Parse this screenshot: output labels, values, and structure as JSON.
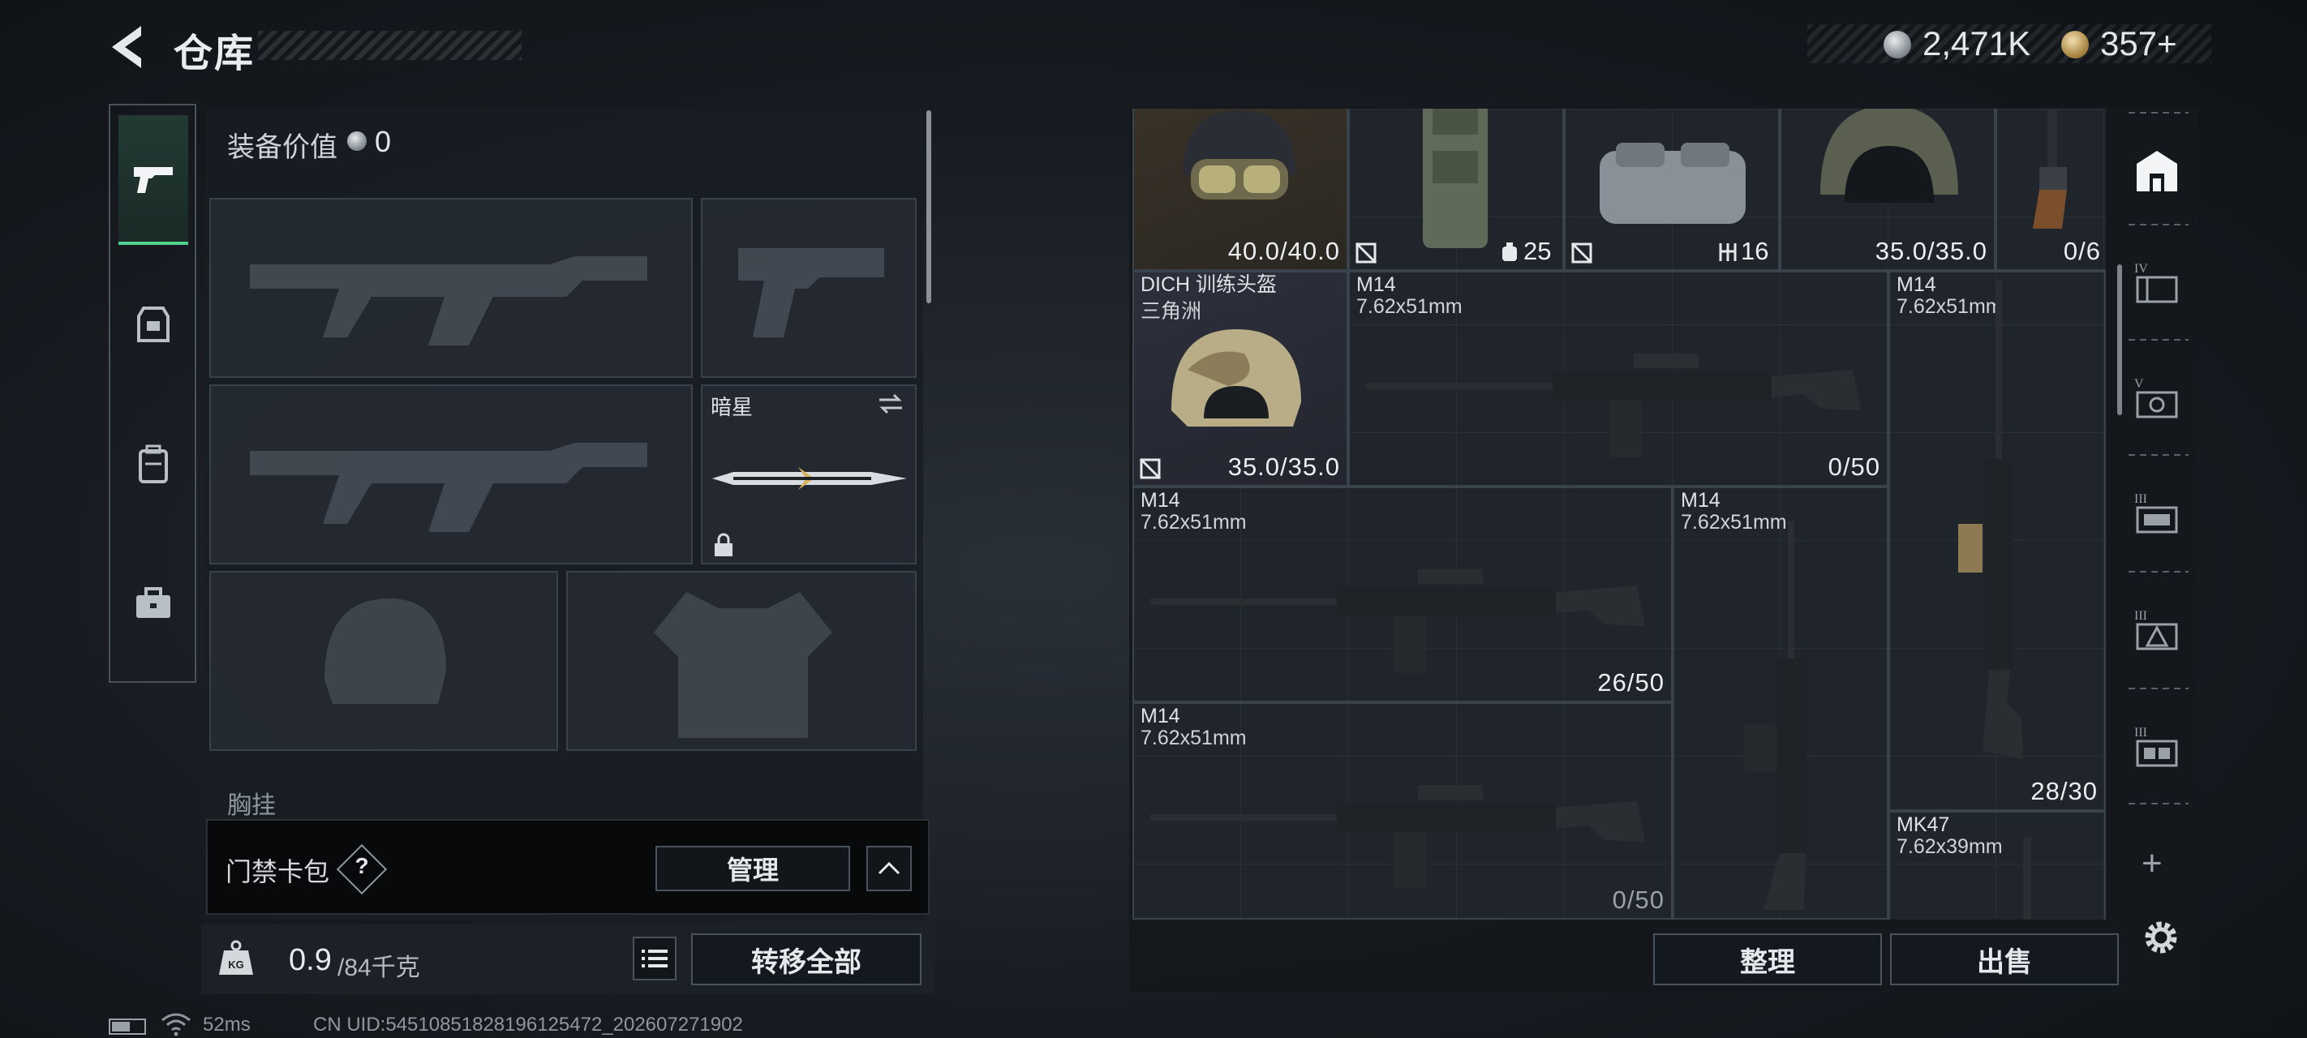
{
  "header": {
    "title": "仓库",
    "currency": {
      "silver": "2,471K",
      "gold": "357+"
    }
  },
  "left_tabs": [
    {
      "name": "firearms",
      "icon": "pistol-icon",
      "active": true
    },
    {
      "name": "helmet-armor",
      "icon": "armor-icon",
      "active": false
    },
    {
      "name": "backpack",
      "icon": "backpack-icon",
      "active": false
    },
    {
      "name": "briefcase",
      "icon": "briefcase-icon",
      "active": false
    }
  ],
  "equipment": {
    "value_label": "装备价值",
    "value": "0",
    "melee_name": "暗星",
    "chest_label": "胸挂",
    "chest_help": "?"
  },
  "access_card": {
    "label": "门禁卡包",
    "help": "?",
    "manage_label": "管理"
  },
  "weight": {
    "current": "0.9",
    "capacity": "/84千克",
    "transfer_all_label": "转移全部"
  },
  "status": {
    "ping": "52ms",
    "uid": "CN UID:545108518281961254​72_202607271902"
  },
  "stash": {
    "items": [
      {
        "id": "helmet-goggles",
        "count": "40.0/40.0",
        "rarity": "rare"
      },
      {
        "id": "vest",
        "badge": "no-insure",
        "count": "25"
      },
      {
        "id": "bag",
        "badge": "no-insure",
        "count": "16"
      },
      {
        "id": "helmet-2",
        "count": "35.0/35.0"
      },
      {
        "id": "revolver",
        "count": "0/6"
      },
      {
        "id": "dich-helmet",
        "name": "DICH 训练头盔",
        "sub": "三角洲",
        "count": "35.0/35.0",
        "rarity": "epic"
      },
      {
        "id": "m14-a",
        "name": "M14",
        "sub": "7.62x51mm",
        "count": "0/50"
      },
      {
        "id": "m14-b",
        "name": "M14",
        "sub": "7.62x51mm",
        "count": "28/30"
      },
      {
        "id": "m14-c",
        "name": "M14",
        "sub": "7.62x51mm",
        "count": "26/50"
      },
      {
        "id": "m14-d",
        "name": "M14",
        "sub": "7.62x51mm"
      },
      {
        "id": "m14-e",
        "name": "M14",
        "sub": "7.62x51mm",
        "count": "0/50"
      },
      {
        "id": "mk47",
        "name": "MK47",
        "sub": "7.62x39mm"
      }
    ],
    "sort_label": "整理",
    "sell_label": "出售"
  },
  "right_tabs": [
    {
      "name": "stash-main",
      "icon": "stash-icon",
      "tier": ""
    },
    {
      "name": "stash-iv",
      "icon": "container-icon",
      "tier": "IV"
    },
    {
      "name": "stash-v",
      "icon": "container-icon",
      "tier": "V"
    },
    {
      "name": "stash-iii-a",
      "icon": "container-icon",
      "tier": "III"
    },
    {
      "name": "stash-iii-b",
      "icon": "container-icon",
      "tier": "III"
    },
    {
      "name": "stash-iii-c",
      "icon": "container-icon",
      "tier": "III"
    }
  ],
  "add_label": "+"
}
